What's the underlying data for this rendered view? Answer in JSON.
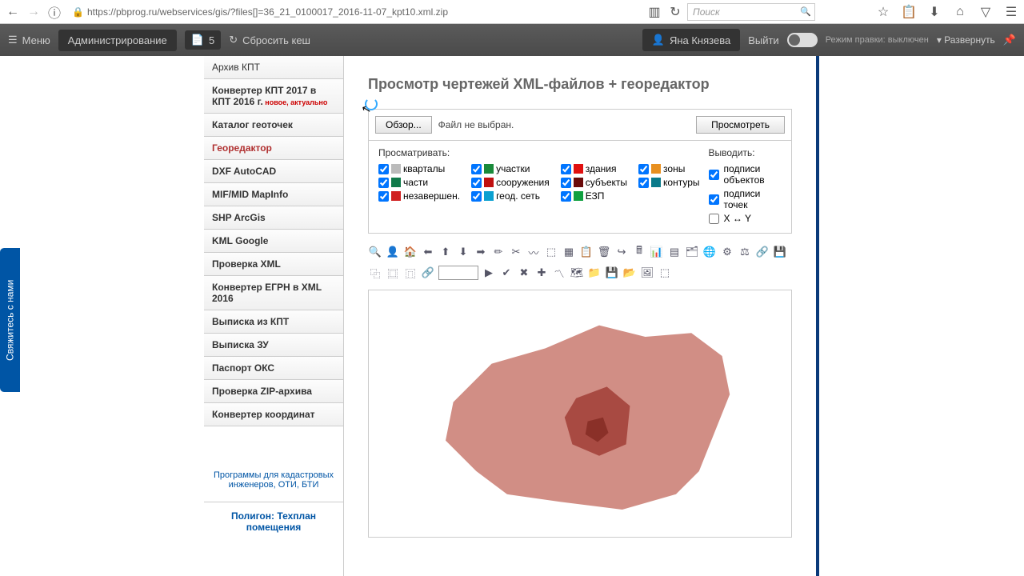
{
  "browser": {
    "url": "https://pbprog.ru/webservices/gis/?files[]=36_21_0100017_2016-11-07_kpt10.xml.zip",
    "search_placeholder": "Поиск"
  },
  "topbar": {
    "menu": "Меню",
    "admin": "Администрирование",
    "count": "5",
    "reset": "Сбросить кеш",
    "user": "Яна Князева",
    "logout": "Выйти",
    "mode_label": "Режим правки:",
    "mode_value": "выключен",
    "expand": "Развернуть"
  },
  "sidebar": {
    "items": [
      {
        "label": "Архив КПТ",
        "bold": false
      },
      {
        "label": "Конвертер КПТ 2017 в КПТ 2016 г.",
        "bold": true,
        "badge": "новое, актуально"
      },
      {
        "label": "Каталог геоточек",
        "bold": true
      },
      {
        "label": "Георедактор",
        "bold": true,
        "active": true
      },
      {
        "label": "DXF AutoCAD",
        "bold": true
      },
      {
        "label": "MIF/MID MapInfo",
        "bold": true
      },
      {
        "label": "SHP ArcGis",
        "bold": true
      },
      {
        "label": "KML Google",
        "bold": true
      },
      {
        "label": "Проверка XML",
        "bold": true
      },
      {
        "label": "Конвертер ЕГРН в XML 2016",
        "bold": true
      },
      {
        "label": "Выписка из КПТ",
        "bold": true
      },
      {
        "label": "Выписка ЗУ",
        "bold": true
      },
      {
        "label": "Паспорт ОКС",
        "bold": true
      },
      {
        "label": "Проверка ZIP-архива",
        "bold": true
      },
      {
        "label": "Конвертер координат",
        "bold": true
      }
    ],
    "promo1": "Программы для кадастровых инженеров, ОТИ, БТИ",
    "promo2": "Полигон: Техплан помещения"
  },
  "contact_tab": "Свяжитесь с нами",
  "main": {
    "title": "Просмотр чертежей XML-файлов + георедактор",
    "browse_btn": "Обзор...",
    "no_file": "Файл не выбран.",
    "view_btn": "Просмотреть",
    "view_header": "Просматривать:",
    "output_header": "Выводить:",
    "layers": [
      {
        "label": "кварталы",
        "color": "#bbb",
        "checked": true
      },
      {
        "label": "участки",
        "color": "#1a8a3a",
        "checked": true
      },
      {
        "label": "здания",
        "color": "#e01010",
        "checked": true
      },
      {
        "label": "зоны",
        "color": "#e89020",
        "checked": true
      },
      {
        "label": "части",
        "color": "#107a4a",
        "checked": true
      },
      {
        "label": "сооружения",
        "color": "#c01010",
        "checked": true
      },
      {
        "label": "субъекты",
        "color": "#6a0a0a",
        "checked": true
      },
      {
        "label": "контуры",
        "color": "#0a7a8a",
        "checked": true
      },
      {
        "label": "незавершен.",
        "color": "#d02020",
        "checked": true
      },
      {
        "label": "геод. сеть",
        "color": "#0aa0d0",
        "checked": true
      },
      {
        "label": "ЕЗП",
        "color": "#10a040",
        "checked": true
      }
    ],
    "outputs": [
      {
        "label": "подписи объектов",
        "checked": true
      },
      {
        "label": "подписи точек",
        "checked": true
      },
      {
        "label": "X ↔ Y",
        "checked": false
      }
    ]
  }
}
